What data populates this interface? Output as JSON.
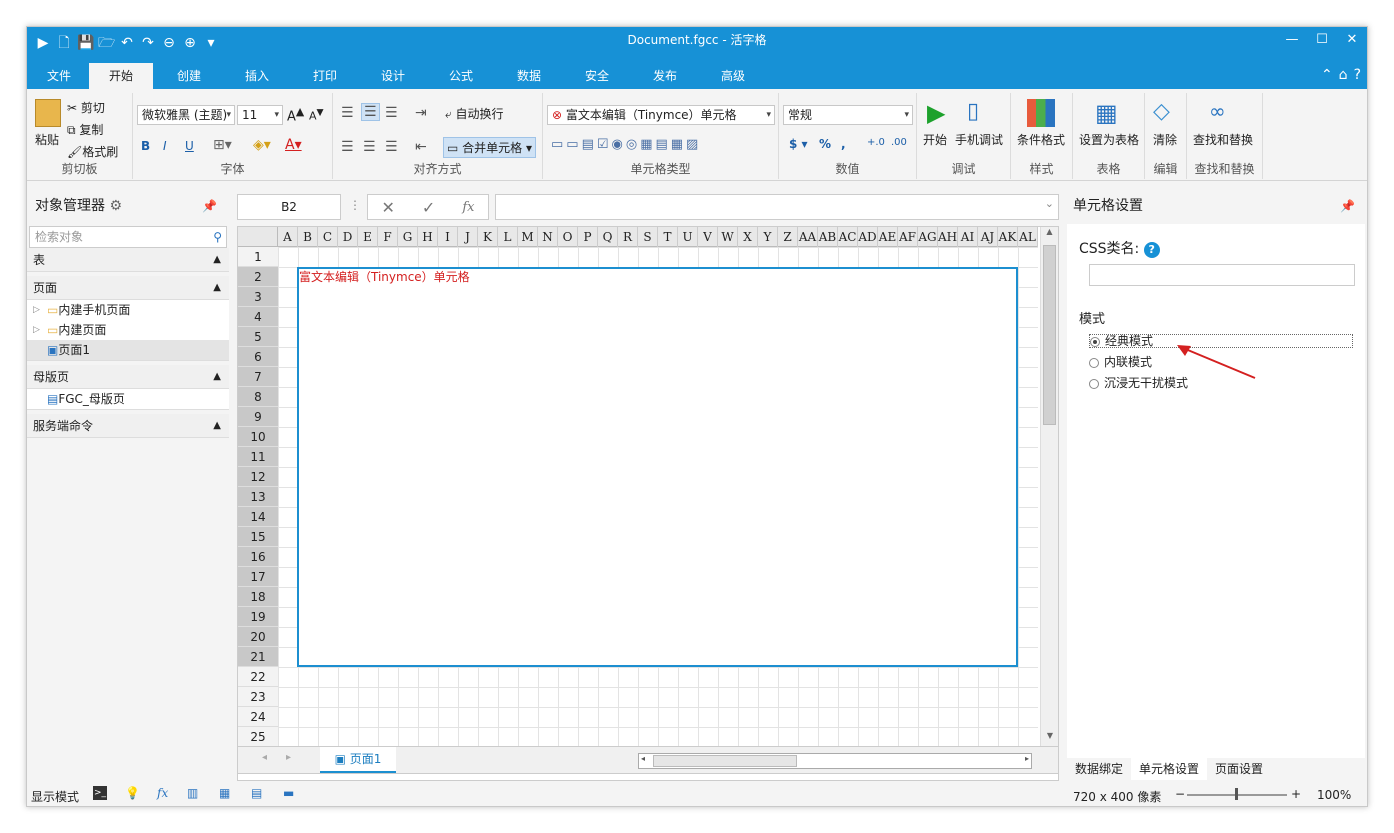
{
  "window": {
    "title": "Document.fgcc - 活字格"
  },
  "tabs": [
    "文件",
    "开始",
    "创建",
    "插入",
    "打印",
    "设计",
    "公式",
    "数据",
    "安全",
    "发布",
    "高级"
  ],
  "active_tab": "开始",
  "ribbon": {
    "clipboard": {
      "paste": "粘贴",
      "cut": "剪切",
      "copy": "复制",
      "format_painter": "格式刷",
      "label": "剪切板"
    },
    "font": {
      "family": "微软雅黑 (主题)",
      "size": "11",
      "bold": "B",
      "italic": "I",
      "underline": "U",
      "label": "字体"
    },
    "align": {
      "wrap": "自动换行",
      "merge": "合并单元格",
      "label": "对齐方式"
    },
    "celltype": {
      "selected": "富文本编辑（Tinymce）单元格",
      "label": "单元格类型"
    },
    "number": {
      "format": "常规",
      "currency": "$",
      "percent": "%",
      "comma": ",",
      "label": "数值"
    },
    "debug": {
      "start": "开始",
      "mobile": "手机调试",
      "label": "调试"
    },
    "style": {
      "conditional": "条件格式",
      "label": "样式"
    },
    "table": {
      "set_table": "设置为表格",
      "label": "表格"
    },
    "edit": {
      "clear": "清除",
      "label": "编辑"
    },
    "find": {
      "find_replace": "查找和替换",
      "label": "查找和替换"
    }
  },
  "left_panel": {
    "title": "对象管理器",
    "search_placeholder": "检索对象",
    "sections": {
      "table": "表",
      "page": "页面",
      "master": "母版页",
      "server": "服务端命令"
    },
    "page_items": [
      "内建手机页面",
      "内建页面",
      "页面1"
    ],
    "master_items": [
      "FGC_母版页"
    ]
  },
  "formula_bar": {
    "cell_ref": "B2",
    "fx": "fx"
  },
  "sheet": {
    "columns": [
      "A",
      "B",
      "C",
      "D",
      "E",
      "F",
      "G",
      "H",
      "I",
      "J",
      "K",
      "L",
      "M",
      "N",
      "O",
      "P",
      "Q",
      "R",
      "S",
      "T",
      "U",
      "V",
      "W",
      "X",
      "Y",
      "Z",
      "AA",
      "AB",
      "AC",
      "AD",
      "AE",
      "AF",
      "AG",
      "AH",
      "AI",
      "AJ",
      "AK",
      "AL"
    ],
    "rows": [
      "1",
      "2",
      "3",
      "4",
      "5",
      "6",
      "7",
      "8",
      "9",
      "10",
      "11",
      "12",
      "13",
      "14",
      "15",
      "16",
      "17",
      "18",
      "19",
      "20",
      "21",
      "22",
      "23",
      "24",
      "25"
    ],
    "cell_text": "富文本编辑（Tinymce）单元格",
    "sheet_tab": "页面1"
  },
  "right_panel": {
    "title": "单元格设置",
    "css_label": "CSS类名:",
    "mode_label": "模式",
    "modes": [
      "经典模式",
      "内联模式",
      "沉浸无干扰模式"
    ],
    "selected_mode": "经典模式",
    "bottom_tabs": [
      "数据绑定",
      "单元格设置",
      "页面设置"
    ],
    "active_bottom_tab": "单元格设置"
  },
  "status": {
    "display_mode": "显示模式",
    "size": "720 x 400 像素",
    "zoom": "100%"
  },
  "colors": {
    "accent": "#1791d6",
    "cell_text": "#d42020",
    "arrow": "#d42020"
  }
}
